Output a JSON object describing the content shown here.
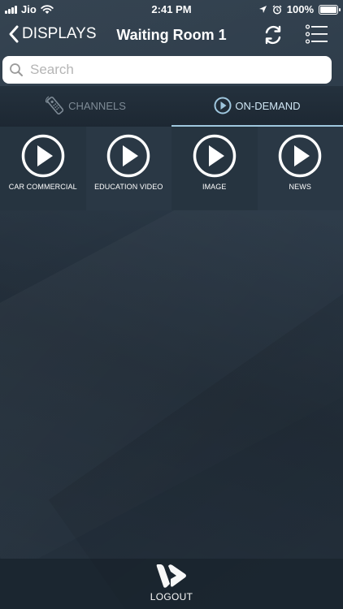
{
  "status_bar": {
    "carrier": "Jio",
    "time": "2:41 PM",
    "battery_percent": "100%"
  },
  "nav": {
    "back_label": "DISPLAYS",
    "title": "Waiting Room 1"
  },
  "search": {
    "placeholder": "Search",
    "value": ""
  },
  "tabs": [
    {
      "label": "CHANNELS",
      "icon": "remote-control-icon",
      "active": false
    },
    {
      "label": "ON-DEMAND",
      "icon": "play-circle-icon",
      "active": true
    }
  ],
  "on_demand_items": [
    {
      "label": "CAR COMMERCIAL"
    },
    {
      "label": "EDUCATION VIDEO"
    },
    {
      "label": "IMAGE"
    },
    {
      "label": "NEWS"
    }
  ],
  "footer": {
    "logout_label": "LOGOUT"
  },
  "colors": {
    "background": "#2b3947",
    "active_tab": "#9fc7de",
    "footer": "#1b2630"
  }
}
